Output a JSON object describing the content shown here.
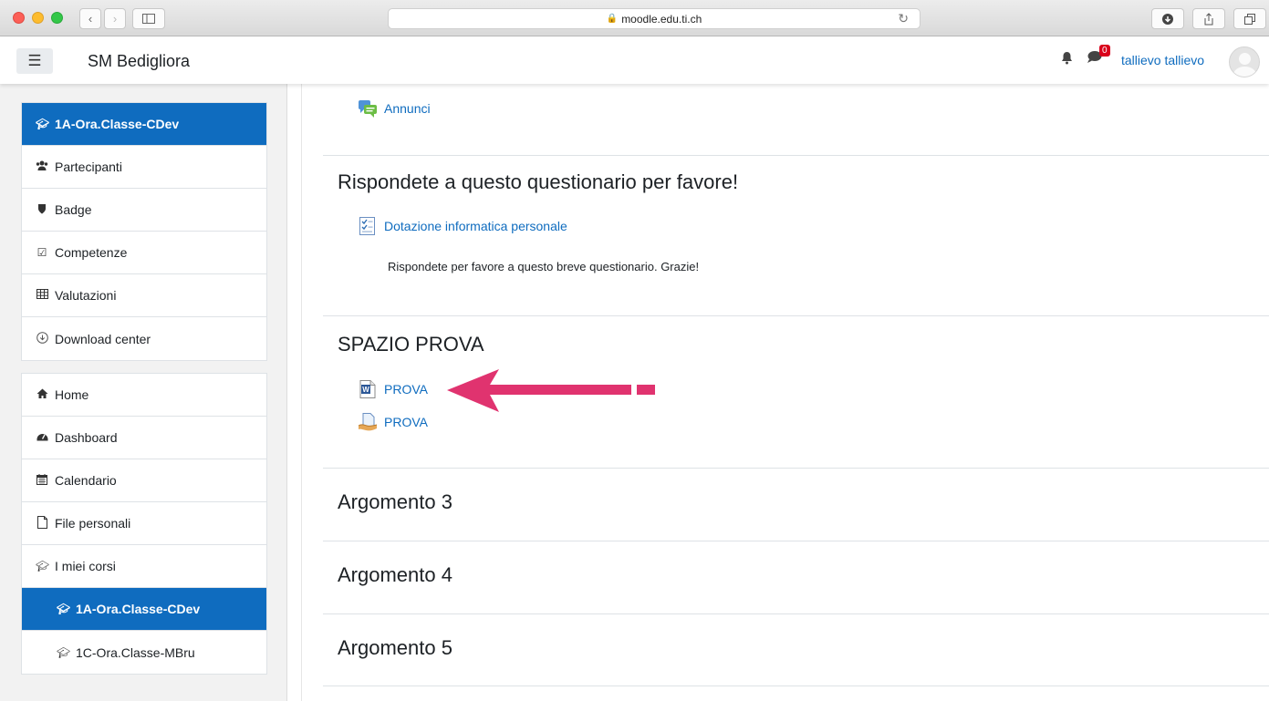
{
  "browser": {
    "url": "moodle.edu.ti.ch"
  },
  "navbar": {
    "site_name": "SM Bedigliora",
    "notification_count": "0",
    "user_name": "tallievo tallievo"
  },
  "sidebar": {
    "course_group": [
      {
        "label": "1A-Ora.Classe-CDev",
        "icon": "graduation-cap-icon",
        "active": true
      },
      {
        "label": "Partecipanti",
        "icon": "users-icon",
        "active": false
      },
      {
        "label": "Badge",
        "icon": "shield-icon",
        "active": false
      },
      {
        "label": "Competenze",
        "icon": "check-square-icon",
        "active": false
      },
      {
        "label": "Valutazioni",
        "icon": "table-icon",
        "active": false
      },
      {
        "label": "Download center",
        "icon": "download-icon",
        "active": false
      }
    ],
    "site_group": [
      {
        "label": "Home",
        "icon": "home-icon",
        "active": false
      },
      {
        "label": "Dashboard",
        "icon": "dashboard-icon",
        "active": false
      },
      {
        "label": "Calendario",
        "icon": "calendar-icon",
        "active": false
      },
      {
        "label": "File personali",
        "icon": "file-icon",
        "active": false
      },
      {
        "label": "I miei corsi",
        "icon": "graduation-cap-icon",
        "active": false
      },
      {
        "label": "1A-Ora.Classe-CDev",
        "icon": "graduation-cap-icon",
        "active": true
      },
      {
        "label": "1C-Ora.Classe-MBru",
        "icon": "graduation-cap-icon",
        "active": false
      }
    ]
  },
  "main": {
    "announcements_link": "Annunci",
    "sections": [
      {
        "title": "Rispondete a questo questionario per favore!",
        "activity": "Dotazione informatica personale",
        "summary": "Rispondete per favore a questo breve questionario. Grazie!"
      },
      {
        "title": "SPAZIO PROVA",
        "activities": [
          "PROVA",
          "PROVA"
        ]
      },
      {
        "title": "Argomento 3"
      },
      {
        "title": "Argomento 4"
      },
      {
        "title": "Argomento 5"
      }
    ]
  },
  "annotation": {
    "arrow_color": "#e0336f"
  }
}
